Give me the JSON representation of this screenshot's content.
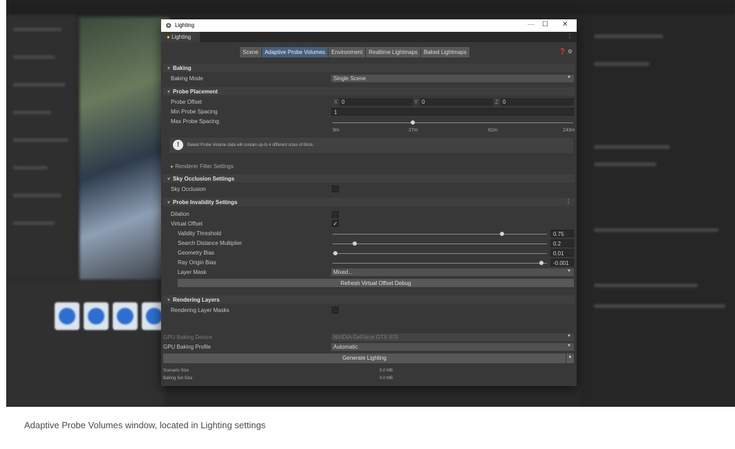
{
  "window": {
    "title": "Lighting",
    "tab": "Lighting",
    "controls": {
      "minimize": "—",
      "maximize": "☐",
      "close": "✕"
    }
  },
  "subtabs": [
    "Scene",
    "Adaptive Probe Volumes",
    "Environment",
    "Realtime Lightmaps",
    "Baked Lightmaps"
  ],
  "active_subtab": "Adaptive Probe Volumes",
  "baking": {
    "header": "Baking",
    "baking_mode_label": "Baking Mode",
    "baking_mode_value": "Single Scene"
  },
  "probe_placement": {
    "header": "Probe Placement",
    "offset_label": "Probe Offset",
    "offset_x_label": "X",
    "offset_x": "0",
    "offset_y_label": "Y",
    "offset_y": "0",
    "offset_z_label": "Z",
    "offset_z": "0",
    "min_spacing_label": "Min Probe Spacing",
    "min_spacing": "1",
    "max_spacing_label": "Max Probe Spacing",
    "max_spacing_ticks": [
      "9m",
      "27m",
      "81m",
      "243m"
    ],
    "info_text": "Baked Probe Volume data will contain up-to 4 different sizes of Brick.",
    "renderer_filter": "Renderer Filter Settings"
  },
  "sky_occlusion": {
    "header": "Sky Occlusion Settings",
    "label": "Sky Occlusion",
    "checked": false
  },
  "probe_invalidity": {
    "header": "Probe Invalidity Settings",
    "dilation_label": "Dilation",
    "dilation_checked": false,
    "virtual_offset_label": "Virtual Offset",
    "virtual_offset_checked": true,
    "validity_threshold_label": "Validity Threshold",
    "validity_threshold": "0.75",
    "search_distance_label": "Search Distance Multiplier",
    "search_distance": "0.2",
    "geometry_bias_label": "Geometry Bias",
    "geometry_bias": "0.01",
    "ray_origin_label": "Ray Origin Bias",
    "ray_origin": "-0.001",
    "layer_mask_label": "Layer Mask",
    "layer_mask_value": "Mixed...",
    "refresh_button": "Refresh Virtual Offset Debug"
  },
  "rendering_layers": {
    "header": "Rendering Layers",
    "label": "Rendering Layer Masks",
    "checked": false
  },
  "gpu": {
    "device_label": "GPU Baking Device",
    "device_value": "NVIDIA GeForce GTX 970",
    "profile_label": "GPU Baking Profile",
    "profile_value": "Automatic"
  },
  "generate_button": "Generate Lighting",
  "sizes": {
    "scenario_label": "Scenario Size",
    "scenario_value": "0.0 MB",
    "baking_set_label": "Baking Set Size",
    "baking_set_value": "0.0 MB"
  },
  "caption": "Adaptive Probe Volumes window, located in Lighting settings",
  "colors": {
    "panel_bg": "#383838",
    "active_tab": "#46607c",
    "section_bg": "#3f3f3f",
    "field_bg": "#2a2a2a"
  },
  "icons": [
    "lighting-icon",
    "info-icon",
    "help-icon",
    "settings-icon",
    "kebab-menu-icon",
    "dropdown-caret-icon",
    "checkmark-icon",
    "foldout-arrow-icon"
  ]
}
